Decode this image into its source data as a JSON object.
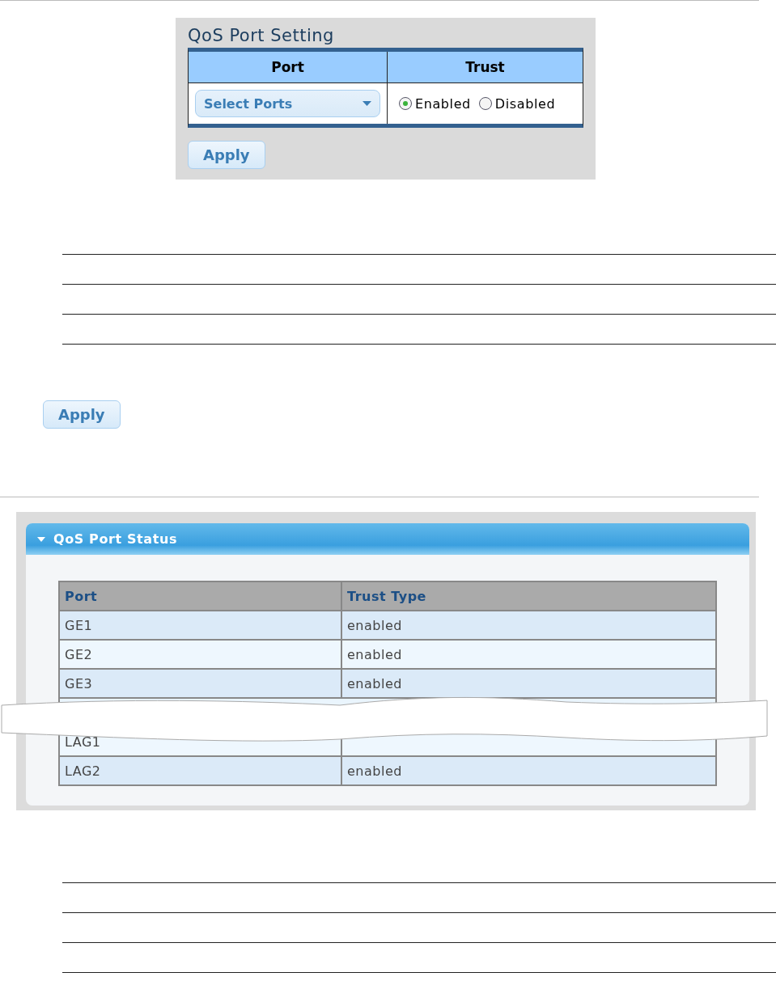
{
  "setting_panel": {
    "title": "QoS Port Setting",
    "columns": [
      "Port",
      "Trust"
    ],
    "port_select": {
      "value": "Select Ports"
    },
    "trust_options": [
      {
        "label": "Enabled",
        "selected": true
      },
      {
        "label": "Disabled",
        "selected": false
      }
    ],
    "apply_button": "Apply"
  },
  "apply_button": "Apply",
  "status_panel": {
    "title": "QoS Port Status",
    "expanded": true,
    "columns": [
      "Port",
      "Trust Type"
    ],
    "rows": [
      {
        "port": "GE1",
        "trust": "enabled"
      },
      {
        "port": "GE2",
        "trust": "enabled"
      },
      {
        "port": "GE3",
        "trust": "enabled"
      },
      {
        "kind": "break"
      },
      {
        "port": "LAG1"
      },
      {
        "port": "LAG2",
        "trust": "enabled"
      }
    ]
  }
}
